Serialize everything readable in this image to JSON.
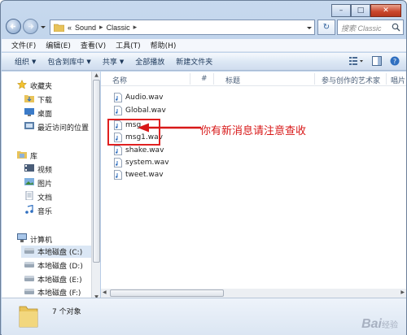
{
  "address": {
    "crumbs": [
      "Sound",
      "Classic"
    ],
    "prefix": "«",
    "search_placeholder": "搜索 Classic"
  },
  "menu": [
    "文件(F)",
    "编辑(E)",
    "查看(V)",
    "工具(T)",
    "帮助(H)"
  ],
  "toolbar": {
    "organize": "组织",
    "include_library": "包含到库中",
    "share": "共享",
    "play_all": "全部播放",
    "new_folder": "新建文件夹"
  },
  "nav": {
    "favorites": "收藏夹",
    "downloads": "下载",
    "desktop": "桌面",
    "recent": "最近访问的位置",
    "libraries": "库",
    "videos": "视频",
    "pictures": "图片",
    "documents": "文档",
    "music": "音乐",
    "computer": "计算机",
    "drive_c": "本地磁盘 (C:)",
    "drive_d": "本地磁盘 (D:)",
    "drive_e": "本地磁盘 (E:)",
    "drive_f": "本地磁盘 (F:)"
  },
  "columns": {
    "name": "名称",
    "number": "#",
    "title": "标题",
    "artist": "参与创作的艺术家",
    "album": "唱片"
  },
  "files": [
    "Audio.wav",
    "Global.wav",
    "msg",
    "msg1.wav",
    "shake.wav",
    "system.wav",
    "tweet.wav"
  ],
  "annotation": "你有新消息请注意查收",
  "status": "7 个对象",
  "watermark": {
    "brand": "Bai",
    "suffix": "经验"
  },
  "colors": {
    "annotation": "#d81818",
    "accent": "#2d5f9a"
  }
}
